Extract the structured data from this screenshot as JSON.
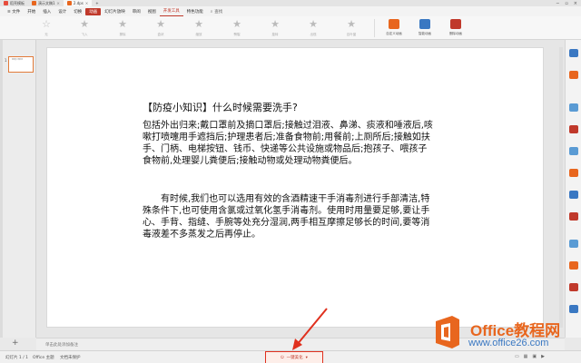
{
  "titlebar": {
    "tabs": [
      {
        "label": "稻壳模板",
        "color": "#e74c3c"
      },
      {
        "label": "演示文稿1",
        "color": "#e8661e"
      },
      {
        "label": "2.dps",
        "color": "#e8661e"
      }
    ]
  },
  "menubar": {
    "file": "≡ 文件",
    "items": [
      "开始",
      "插入",
      "设计",
      "切换",
      "动画",
      "幻灯片放映",
      "审阅",
      "视图",
      "开发工具",
      "特色功能"
    ],
    "selected": "动画",
    "highlighted": "开发工具",
    "search": "查找"
  },
  "ribbon": {
    "animations": [
      "无",
      "飞入",
      "擦除",
      "盒状",
      "缩放",
      "劈裂",
      "旋转",
      "出现",
      "百叶窗"
    ],
    "tools": [
      {
        "label": "自定义动画",
        "color": "#e8661e"
      },
      {
        "label": "智能动画",
        "color": "#3a78c2"
      },
      {
        "label": "删除动画",
        "color": "#c0392b"
      }
    ]
  },
  "thumbs": {
    "number": "1",
    "preview": "【防疫小知识】"
  },
  "slide": {
    "title": "【防疫小知识】什么时候需要洗手?",
    "para1": "包括外出归来;戴口罩前及摘口罩后;接触过泪液、鼻涕、痰液和唾液后,咳嗽打喷嚏用手遮挡后;护理患者后;准备食物前;用餐前;上厕所后;接触如扶手、门柄、电梯按钮、钱币、快递等公共设施或物品后;抱孩子、喂孩子食物前,处理婴儿粪便后;接触动物或处理动物粪便后。",
    "para2": "有时候,我们也可以选用有效的含酒精速干手消毒剂进行手部清洁,特殊条件下,也可使用含氯或过氧化氢手消毒剂。使用时用量要足够,要让手心、手背、指缝、手腕等处充分湿润,两手相互摩擦足够长的时间,要等消毒液差不多蒸发之后再停止。"
  },
  "notes": {
    "placeholder": "单击此处添加备注"
  },
  "statusbar": {
    "slide_count": "幻灯片 1 / 1",
    "theme": "Office 主题",
    "protect": "文档未保护",
    "beautify": "一键美化"
  },
  "watermark": {
    "name": "Office教程网",
    "url": "www.office26.com"
  },
  "colors": {
    "accent": "#c0392b",
    "orange": "#e8661e",
    "blue": "#3a78c2"
  }
}
